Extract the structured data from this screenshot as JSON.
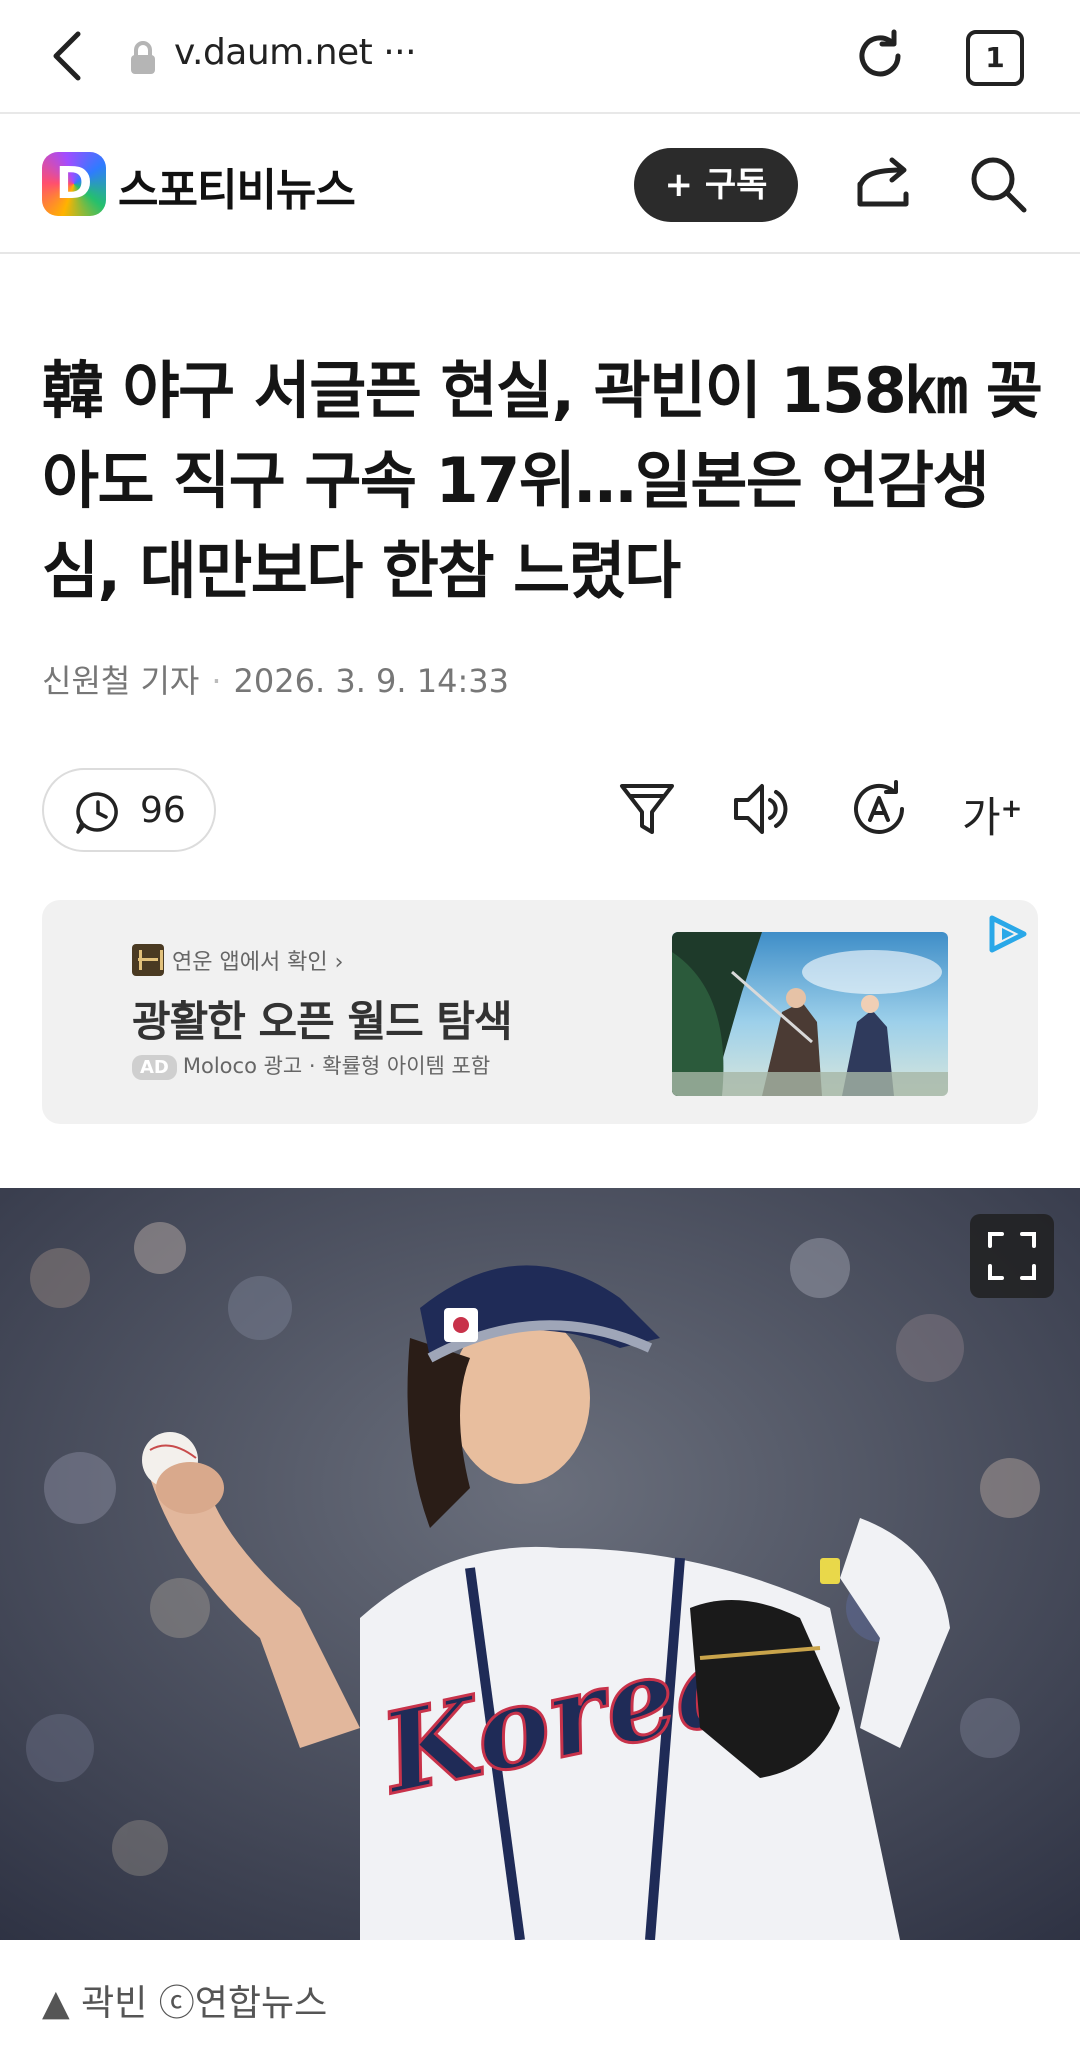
{
  "browser": {
    "url": "v.daum.net ···",
    "tab_count": "1",
    "icons": [
      "back-icon",
      "lock-icon",
      "reload-icon",
      "tabs-icon"
    ]
  },
  "site": {
    "logo_letter": "D",
    "name": "스포티비뉴스",
    "subscribe_label": "+ 구독",
    "icons": [
      "share-icon",
      "search-icon"
    ]
  },
  "article": {
    "title": "韓 야구 서글픈 현실, 곽빈이 158㎞ 꽂아도 직구 구속 17위…일본은 언감생심, 대만보다 한참 느렸다",
    "author": "신원철 기자",
    "separator": "·",
    "datetime": "2026. 3. 9. 14:33",
    "comment_count": "96",
    "font_size_label": "가",
    "tools": [
      "filter-icon",
      "speaker-icon",
      "translate-icon",
      "font-size-icon"
    ]
  },
  "ad": {
    "app_link": "연운 앱에서 확인 ›",
    "headline": "광활한 오픈 월드 탐색",
    "badge": "AD",
    "meta": "Moloco 광고 · 확률형 아이템 포함"
  },
  "photo": {
    "jersey_text": "Korea",
    "caption": "▲ 곽빈 ⓒ연합뉴스"
  },
  "colors": {
    "accent_dark": "#2b2b2b",
    "text": "#151515",
    "muted": "#777777"
  }
}
